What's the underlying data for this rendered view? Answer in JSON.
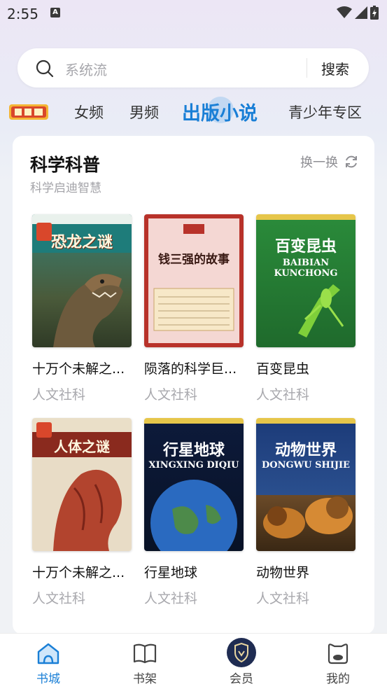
{
  "status_bar": {
    "time": "2:55",
    "notification_badge": "A"
  },
  "search": {
    "placeholder": "系统流",
    "button_label": "搜索"
  },
  "tabs": [
    {
      "label": "女频"
    },
    {
      "label": "男频"
    },
    {
      "label": "出版小说",
      "active": true
    },
    {
      "label": "青少年专区"
    }
  ],
  "section": {
    "title": "科学科普",
    "subtitle": "科学启迪智慧",
    "refresh_label": "换一换"
  },
  "books": [
    {
      "title": "十万个未解之...",
      "author": "人文社科",
      "cover_text": "恐龙之谜"
    },
    {
      "title": "陨落的科学巨...",
      "author": "人文社科",
      "cover_text": "钱三强的故事"
    },
    {
      "title": "百变昆虫",
      "author": "人文社科",
      "cover_text": "百变昆虫",
      "cover_sub": "BAIBIAN KUNCHONG"
    },
    {
      "title": "十万个未解之...",
      "author": "人文社科",
      "cover_text": "人体之谜"
    },
    {
      "title": "行星地球",
      "author": "人文社科",
      "cover_text": "行星地球",
      "cover_sub": "XINGXING DIQIU"
    },
    {
      "title": "动物世界",
      "author": "人文社科",
      "cover_text": "动物世界",
      "cover_sub": "DONGWU SHIJIE"
    }
  ],
  "bottom_nav": [
    {
      "label": "书城",
      "icon": "home-icon",
      "active": true
    },
    {
      "label": "书架",
      "icon": "book-icon"
    },
    {
      "label": "会员",
      "icon": "vip-shield-icon"
    },
    {
      "label": "我的",
      "icon": "profile-icon"
    }
  ],
  "colors": {
    "accent": "#1a7fd6",
    "muted_text": "#a8a8ad"
  }
}
